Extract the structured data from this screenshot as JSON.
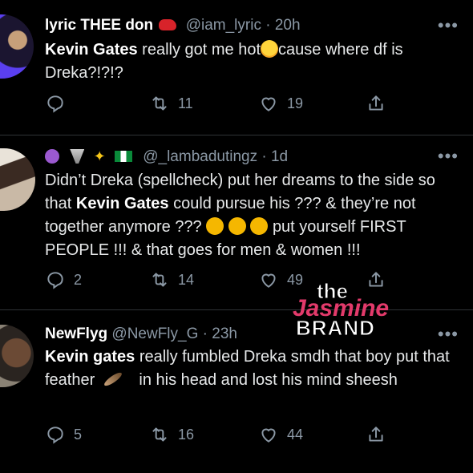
{
  "tweets": [
    {
      "name": "lyric THEE don",
      "handle": "@iam_lyric",
      "time": "· 20h",
      "more": "•••",
      "text_parts": [
        "Kevin Gates",
        " really got me hot",
        "cause where df is Dreka?!?!?"
      ],
      "replies": "",
      "retweets": "11",
      "likes": "19"
    },
    {
      "name": "",
      "handle": "@_lambadutingz",
      "time": "· 1d",
      "more": "•••",
      "text_parts": [
        "Didn’t Dreka (spellcheck) put her dreams to the side so that ",
        "Kevin Gates",
        " could pursue his ??? & they’re not together anymore ???",
        "put yourself FIRST PEOPLE !!! & that goes for men & women !!!"
      ],
      "replies": "2",
      "retweets": "14",
      "likes": "49"
    },
    {
      "name": "NewFlyg",
      "handle": "@NewFly_G",
      "time": "· 23h",
      "more": "•••",
      "text_parts": [
        "Kevin gates",
        " really fumbled Dreka smdh that boy put that feather",
        "in his head and lost his mind sheesh"
      ],
      "replies": "5",
      "retweets": "16",
      "likes": "44"
    }
  ],
  "watermark": {
    "top": "the",
    "middle": "Jasmine",
    "bottom": "BRAND"
  },
  "icons": [
    "reply-icon",
    "retweet-icon",
    "like-icon",
    "share-icon",
    "more-icon"
  ],
  "colors": {
    "background": "#000000",
    "muted": "#8b98a5",
    "divider": "#2f3336",
    "watermark_pink": "#e33a6b"
  }
}
